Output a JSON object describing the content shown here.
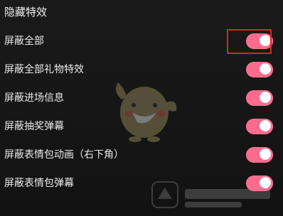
{
  "section": {
    "title": "隐藏特效"
  },
  "settings": [
    {
      "label": "屏蔽全部",
      "enabled": true,
      "highlighted": true
    },
    {
      "label": "屏蔽全部礼物特效",
      "enabled": true,
      "highlighted": false
    },
    {
      "label": "屏蔽进场信息",
      "enabled": true,
      "highlighted": false
    },
    {
      "label": "屏蔽抽奖弹幕",
      "enabled": true,
      "highlighted": false
    },
    {
      "label": "屏蔽表情包动画（右下角）",
      "enabled": true,
      "highlighted": false
    },
    {
      "label": "屏蔽表情包弹幕",
      "enabled": true,
      "highlighted": false
    }
  ],
  "colors": {
    "background": "#141414",
    "toggle_on": "#ff6b8e",
    "highlight_border": "#e2211c"
  },
  "icons": {
    "mascot": "chick-mascot-icon",
    "watermark": "watermark-logo"
  }
}
